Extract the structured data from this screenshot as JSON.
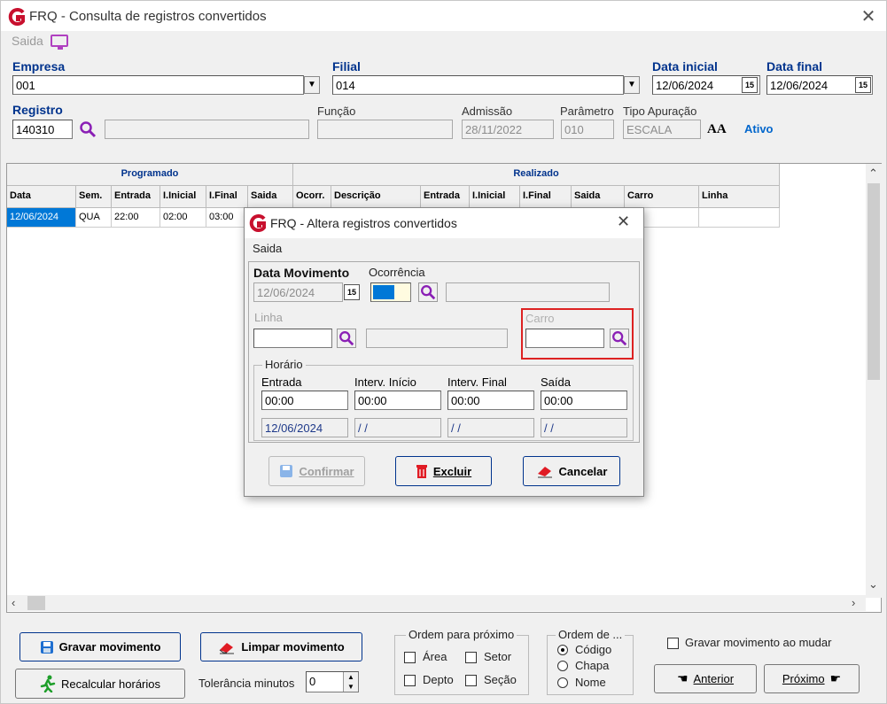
{
  "window": {
    "title": "FRQ - Consulta de registros convertidos",
    "menu_saida": "Saida"
  },
  "header": {
    "empresa_label": "Empresa",
    "empresa_value": "001",
    "filial_label": "Filial",
    "filial_value": "014",
    "data_inicial_label": "Data inicial",
    "data_inicial_value": "12/06/2024",
    "data_final_label": "Data final",
    "data_final_value": "12/06/2024",
    "registro_label": "Registro",
    "registro_value": "140310",
    "funcao_label": "Função",
    "admissao_label": "Admissão",
    "admissao_value": "28/11/2022",
    "parametro_label": "Parâmetro",
    "parametro_value": "010",
    "tipo_apuracao_label": "Tipo Apuração",
    "tipo_apuracao_value": "ESCALA",
    "status": "Ativo",
    "font_icon_text": "AA"
  },
  "grid": {
    "group_programado": "Programado",
    "group_realizado": "Realizado",
    "columns": [
      "Data",
      "Sem.",
      "Entrada",
      "I.Inicial",
      "I.Final",
      "Saida",
      "Ocorr.",
      "Descrição",
      "Entrada",
      "I.Inicial",
      "I.Final",
      "Saida",
      "Carro",
      "Linha"
    ],
    "rows": [
      [
        "12/06/2024",
        "QUA",
        "22:00",
        "02:00",
        "03:00",
        "",
        "",
        "",
        "",
        "",
        "",
        "",
        "",
        ""
      ]
    ]
  },
  "dialog": {
    "title": "FRQ - Altera registros convertidos",
    "menu_saida": "Saida",
    "data_movimento_label": "Data Movimento",
    "data_movimento_value": "12/06/2024",
    "ocorrencia_label": "Ocorrência",
    "linha_label": "Linha",
    "carro_label": "Carro",
    "horario_title": "Horário",
    "entrada_label": "Entrada",
    "interv_inicio_label": "Interv. Início",
    "interv_final_label": "Interv. Final",
    "saida_label": "Saída",
    "entrada_value": "00:00",
    "interv_inicio_value": "00:00",
    "interv_final_value": "00:00",
    "saida_value": "00:00",
    "entrada_date": "12/06/2024",
    "interv_inicio_date": "/ /",
    "interv_final_date": "/ /",
    "saida_date": "/ /",
    "confirmar_label": "Confirmar",
    "excluir_label": "Excluir",
    "cancelar_label": "Cancelar"
  },
  "footer": {
    "gravar_label": "Gravar movimento",
    "limpar_label": "Limpar movimento",
    "recalcular_label": "Recalcular horários",
    "tolerancia_label": "Tolerância minutos",
    "tolerancia_value": "0",
    "ordem_proximo_title": "Ordem para próximo",
    "area_label": "Área",
    "setor_label": "Setor",
    "depto_label": "Depto",
    "secao_label": "Seção",
    "ordem_de_title": "Ordem de ...",
    "codigo_label": "Código",
    "chapa_label": "Chapa",
    "nome_label": "Nome",
    "gravar_ao_mudar_label": "Gravar movimento ao mudar",
    "anterior_label": "Anterior",
    "proximo_label": "Próximo"
  },
  "colors": {
    "accent_blue": "#00338d",
    "selection_blue": "#0078d7",
    "highlight_red": "#dd2222"
  }
}
